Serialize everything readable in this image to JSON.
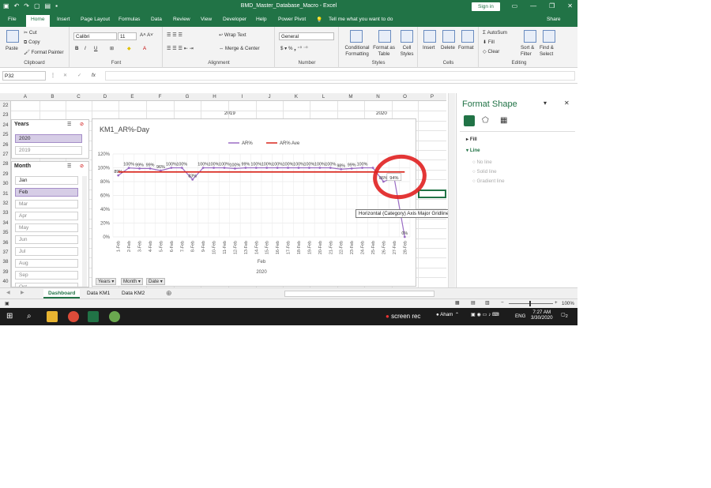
{
  "window": {
    "title": "BMD_Master_Database_Macro  -  Excel",
    "signin": "Sign in",
    "share": "Share",
    "tell_me": "Tell me what you want to do"
  },
  "tabs": [
    "File",
    "Home",
    "Insert",
    "Page Layout",
    "Formulas",
    "Data",
    "Review",
    "View",
    "Developer",
    "Help",
    "Power Pivot"
  ],
  "ribbon": {
    "clipboard": {
      "paste": "Paste",
      "cut": "Cut",
      "copy": "Copy",
      "format_painter": "Format Painter",
      "label": "Clipboard"
    },
    "font": {
      "name": "Calibri",
      "size": "11",
      "label": "Font"
    },
    "alignment": {
      "wrap": "Wrap Text",
      "merge": "Merge & Center",
      "label": "Alignment"
    },
    "number": {
      "format": "General",
      "label": "Number"
    },
    "styles": {
      "conditional": "Conditional Formatting",
      "format_as_table": "Format as Table",
      "cell_styles": "Cell Styles",
      "label": "Styles"
    },
    "cells": {
      "insert": "Insert",
      "delete": "Delete",
      "format": "Format",
      "label": "Cells"
    },
    "editing": {
      "autosum": "AutoSum",
      "fill": "Fill",
      "clear": "Clear",
      "sort": "Sort & Filter",
      "find": "Find & Select",
      "label": "Editing"
    }
  },
  "formula_bar": {
    "name_box": "P32",
    "fx": "fx"
  },
  "columns": [
    "A",
    "B",
    "C",
    "D",
    "E",
    "F",
    "G",
    "H",
    "I",
    "J",
    "K",
    "L",
    "M",
    "N",
    "O",
    "P"
  ],
  "rows": [
    "22",
    "23",
    "24",
    "25",
    "26",
    "27",
    "28",
    "29",
    "30",
    "31",
    "32",
    "33",
    "34",
    "35",
    "36",
    "37",
    "38",
    "39",
    "40"
  ],
  "header_band": {
    "year_2019": "2019",
    "year_2020": "2020"
  },
  "years_slicer": {
    "title": "Years",
    "items": [
      "2020",
      "2019"
    ]
  },
  "month_slicer": {
    "title": "Month",
    "items": [
      "Jan",
      "Feb",
      "Mar",
      "Apr",
      "May",
      "Jun",
      "Jul",
      "Aug",
      "Sep",
      "Oct"
    ]
  },
  "pivot_buttons": [
    "Years",
    "Month",
    "Date"
  ],
  "tooltip": "Horizontal (Category) Axis Major Gridlines",
  "chart_data": {
    "type": "line",
    "title": "KM1_AR%-Day",
    "xlabel": "Feb",
    "xlabel2": "2020",
    "categories": [
      "1-Feb",
      "2-Feb",
      "3-Feb",
      "4-Feb",
      "5-Feb",
      "6-Feb",
      "7-Feb",
      "8-Feb",
      "9-Feb",
      "10-Feb",
      "11-Feb",
      "12-Feb",
      "13-Feb",
      "14-Feb",
      "15-Feb",
      "16-Feb",
      "17-Feb",
      "18-Feb",
      "19-Feb",
      "20-Feb",
      "21-Feb",
      "22-Feb",
      "23-Feb",
      "24-Feb",
      "25-Feb",
      "26-Feb",
      "27-Feb",
      "28-Feb"
    ],
    "yticks": [
      "0%",
      "20%",
      "40%",
      "60%",
      "80%",
      "100%",
      "120%"
    ],
    "ylim": [
      0,
      1.2
    ],
    "series": [
      {
        "name": "AR%",
        "color": "#9a6cc4",
        "values": [
          0.89,
          0.998,
          0.99,
          0.99,
          0.96,
          1.0,
          1.0,
          0.83,
          1.0,
          1.0,
          1.0,
          0.99,
          1.0,
          1.0,
          1.0,
          1.0,
          1.0,
          1.0,
          1.0,
          1.0,
          1.0,
          0.98,
          0.99,
          1.0,
          1.0,
          0.8,
          0.86,
          0.0
        ],
        "labels": [
          "89%",
          "100%",
          "99%",
          "99%",
          "96%",
          "100%",
          "100%",
          "83%",
          "100%",
          "100%",
          "100%",
          "100%",
          "99%",
          "100%",
          "100%",
          "100%",
          "100%",
          "100%",
          "100%",
          "100%",
          "100%",
          "98%",
          "99%",
          "100%",
          "",
          "86%",
          "",
          "0%"
        ]
      },
      {
        "name": "AR% Ave",
        "color": "#d9261c",
        "values": [
          0.94,
          0.94,
          0.94,
          0.94,
          0.94,
          0.94,
          0.94,
          0.94,
          0.94,
          0.94,
          0.94,
          0.94,
          0.94,
          0.94,
          0.94,
          0.94,
          0.94,
          0.94,
          0.94,
          0.94,
          0.94,
          0.94,
          0.94,
          0.94,
          0.94,
          0.94,
          0.94,
          0.94
        ]
      }
    ],
    "callout": "94%",
    "legend": "top"
  },
  "format_pane": {
    "title": "Format Shape",
    "fill": "Fill",
    "line": "Line",
    "options": [
      "No line",
      "Solid line",
      "Gradient line"
    ]
  },
  "sheet_tabs": [
    "Dashboard",
    "Data KM1",
    "Data KM2"
  ],
  "status": {
    "zoom": "100%"
  },
  "taskbar": {
    "screenrec": "screen rec",
    "user": "Aham",
    "lang": "ENG",
    "time": "7:27 AM",
    "date": "3/30/2020",
    "notif": "2"
  }
}
